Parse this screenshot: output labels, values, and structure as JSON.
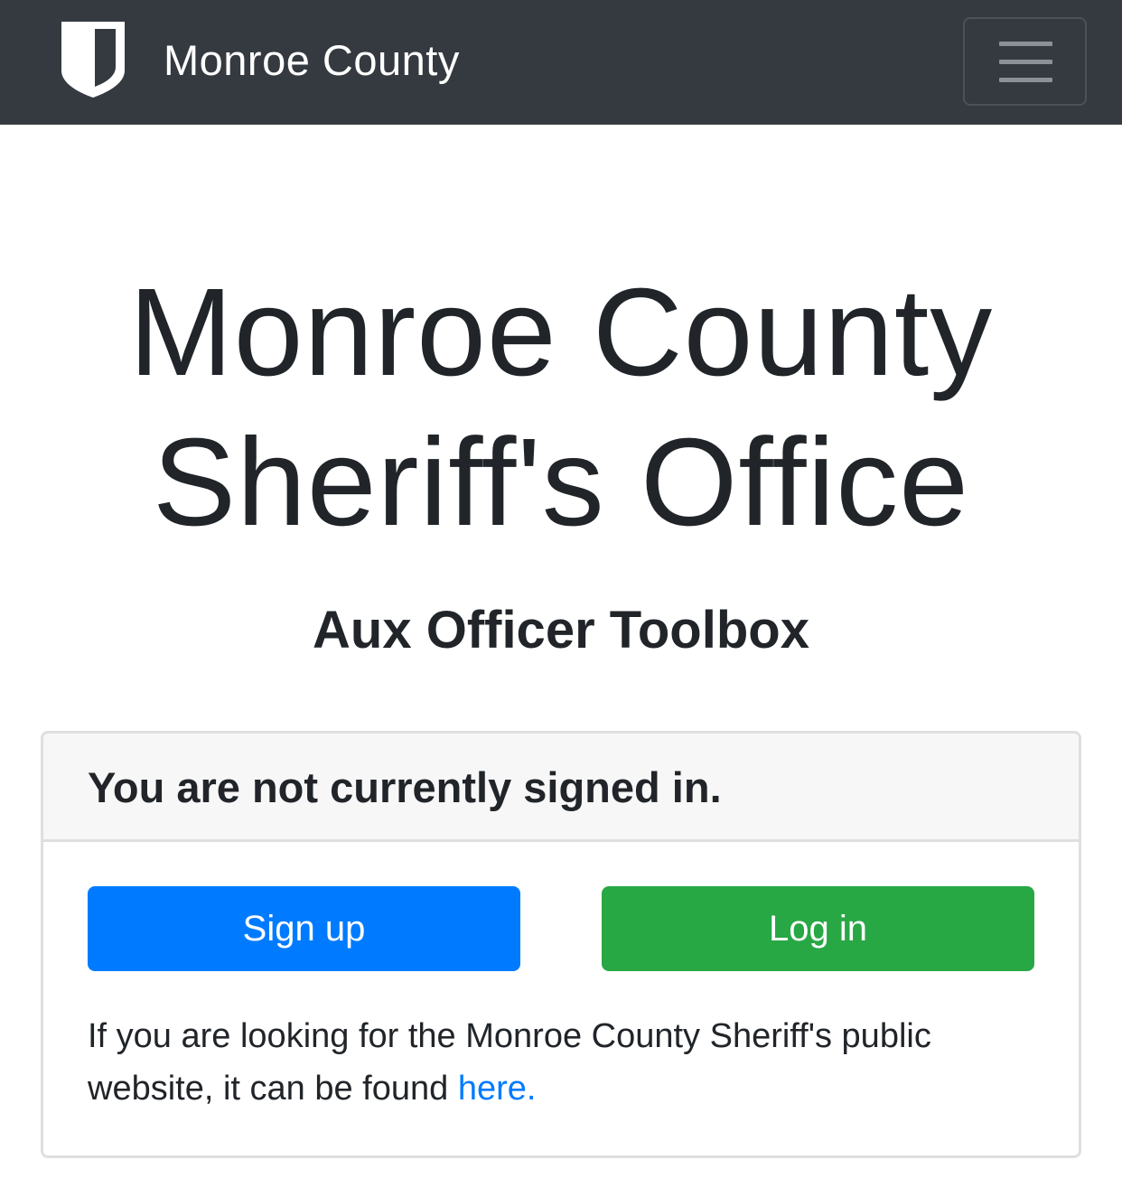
{
  "navbar": {
    "brand_text": "Monroe County",
    "logo_icon": "shield-icon",
    "menu_icon": "hamburger-menu-icon"
  },
  "hero": {
    "title_line1": "Monroe County",
    "title_line2": "Sheriff's Office",
    "subtitle": "Aux Officer Toolbox"
  },
  "card": {
    "header": "You are not currently signed in.",
    "signup_label": "Sign up",
    "login_label": "Log in",
    "note_text": "If you are looking for the Monroe County Sheriff's public website, it can be found ",
    "note_link": "here."
  },
  "colors": {
    "navbar_bg": "#343a40",
    "primary": "#007bff",
    "success": "#28a745",
    "text": "#212529"
  }
}
